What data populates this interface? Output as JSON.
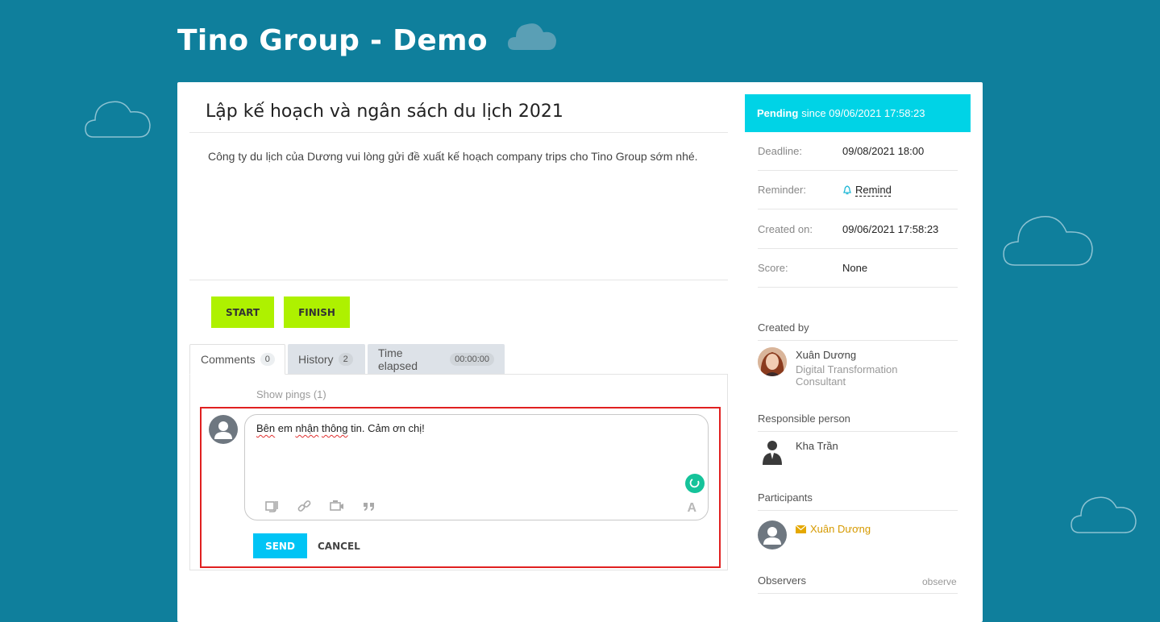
{
  "site": {
    "title": "Tino Group - Demo"
  },
  "task": {
    "title": "Lập kế hoạch và ngân sách du lịch 2021",
    "description": "Công ty du lịch của Dương vui lòng gửi đề xuất kế hoạch company trips cho Tino Group sớm nhé."
  },
  "actions": {
    "start_label": "START",
    "finish_label": "FINISH"
  },
  "tabs": [
    {
      "label": "Comments",
      "count": "0"
    },
    {
      "label": "History",
      "count": "2"
    },
    {
      "label": "Time elapsed",
      "count": "00:00:00"
    }
  ],
  "comments": {
    "show_pings": "Show pings (1)",
    "editor": {
      "word1": "Bên",
      "sp1": " em ",
      "word2": "nhận",
      "sp2": " ",
      "word3": "thông",
      "rest": " tin. Cảm ơn chị!"
    },
    "send_label": "SEND",
    "cancel_label": "CANCEL",
    "tool_icons": [
      "attach-file-icon",
      "link-icon",
      "video-icon",
      "quote-icon"
    ]
  },
  "sidebar": {
    "status": {
      "state": "Pending",
      "since": "since 09/06/2021 17:58:23"
    },
    "fields": [
      {
        "label": "Deadline:",
        "value": "09/08/2021 18:00"
      },
      {
        "label": "Reminder:",
        "value": "Remind"
      },
      {
        "label": "Created on:",
        "value": "09/06/2021 17:58:23"
      },
      {
        "label": "Score:",
        "value": "None"
      }
    ],
    "created_by": {
      "title": "Created by",
      "name": "Xuân Dương",
      "role": "Digital Transformation Consultant"
    },
    "responsible": {
      "title": "Responsible person",
      "name": "Kha Trần"
    },
    "participants": {
      "title": "Participants",
      "name": "Xuân Dương"
    },
    "observers": {
      "title": "Observers",
      "action": "observe"
    }
  },
  "colors": {
    "background": "#0f7f9c",
    "status": "#00d3e6",
    "action_buttons": "#aef100",
    "send_button": "#00c4f5",
    "participant_name": "#d69a00",
    "highlight_border": "#e02020"
  }
}
